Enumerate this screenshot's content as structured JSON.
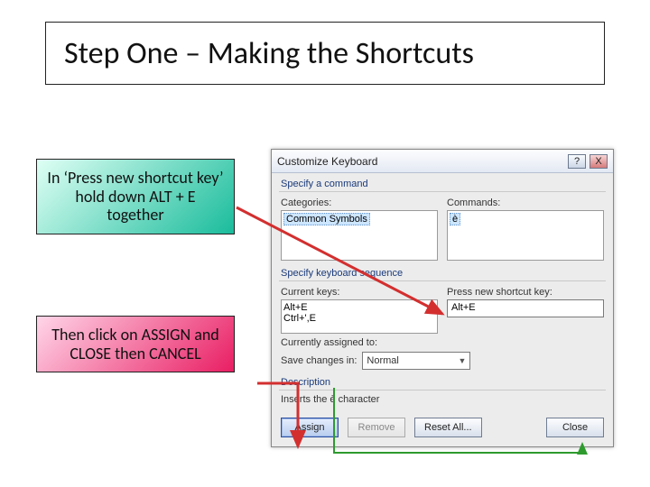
{
  "title": "Step One – Making the Shortcuts",
  "callouts": {
    "top": "In ‘Press new shortcut key’ hold down ALT + E together",
    "bottom": "Then click on ASSIGN and CLOSE then CANCEL"
  },
  "dialog": {
    "title": "Customize Keyboard",
    "help_label": "?",
    "close_label": "X",
    "group_specify_command": "Specify a command",
    "label_categories": "Categories:",
    "label_commands": "Commands:",
    "category_selected": "Common Symbols",
    "command_selected": "è",
    "group_specify_sequence": "Specify keyboard sequence",
    "label_current_keys": "Current keys:",
    "label_press_new": "Press new shortcut key:",
    "current_keys": "Alt+E\nCtrl+',E",
    "press_new": "Alt+E",
    "label_assigned": "Currently assigned to:",
    "assigned_value": "",
    "label_save_in": "Save changes in:",
    "save_in_value": "Normal",
    "group_description": "Description",
    "description_text": "Inserts the è character",
    "buttons": {
      "assign": "Assign",
      "remove": "Remove",
      "reset_all": "Reset All...",
      "close": "Close"
    }
  }
}
